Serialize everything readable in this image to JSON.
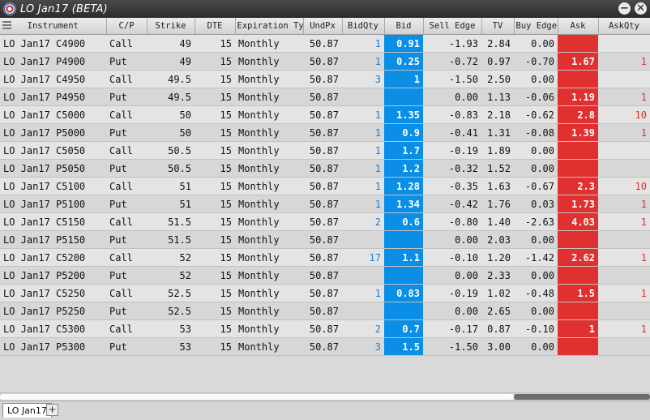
{
  "window": {
    "title": "LO Jan17 (BETA)"
  },
  "columns": [
    "Instrument",
    "C/P",
    "Strike",
    "DTE",
    "Expiration Typ",
    "UndPx",
    "BidQty",
    "Bid",
    "Sell Edge",
    "TV",
    "Buy Edge",
    "Ask",
    "AskQty"
  ],
  "rows": [
    {
      "instrument": "LO Jan17 C4900",
      "cp": "Call",
      "strike": "49",
      "dte": "15",
      "exp": "Monthly",
      "undpx": "50.87",
      "bidqty": "1",
      "bid": "0.91",
      "selledge": "-1.93",
      "tv": "2.84",
      "buyedge": "0.00",
      "ask": "",
      "askqty": ""
    },
    {
      "instrument": "LO Jan17 P4900",
      "cp": "Put",
      "strike": "49",
      "dte": "15",
      "exp": "Monthly",
      "undpx": "50.87",
      "bidqty": "1",
      "bid": "0.25",
      "selledge": "-0.72",
      "tv": "0.97",
      "buyedge": "-0.70",
      "ask": "1.67",
      "askqty": "1"
    },
    {
      "instrument": "LO Jan17 C4950",
      "cp": "Call",
      "strike": "49.5",
      "dte": "15",
      "exp": "Monthly",
      "undpx": "50.87",
      "bidqty": "3",
      "bid": "1",
      "selledge": "-1.50",
      "tv": "2.50",
      "buyedge": "0.00",
      "ask": "",
      "askqty": ""
    },
    {
      "instrument": "LO Jan17 P4950",
      "cp": "Put",
      "strike": "49.5",
      "dte": "15",
      "exp": "Monthly",
      "undpx": "50.87",
      "bidqty": "",
      "bid": "",
      "selledge": "0.00",
      "tv": "1.13",
      "buyedge": "-0.06",
      "ask": "1.19",
      "askqty": "1"
    },
    {
      "instrument": "LO Jan17 C5000",
      "cp": "Call",
      "strike": "50",
      "dte": "15",
      "exp": "Monthly",
      "undpx": "50.87",
      "bidqty": "1",
      "bid": "1.35",
      "selledge": "-0.83",
      "tv": "2.18",
      "buyedge": "-0.62",
      "ask": "2.8",
      "askqty": "10"
    },
    {
      "instrument": "LO Jan17 P5000",
      "cp": "Put",
      "strike": "50",
      "dte": "15",
      "exp": "Monthly",
      "undpx": "50.87",
      "bidqty": "1",
      "bid": "0.9",
      "selledge": "-0.41",
      "tv": "1.31",
      "buyedge": "-0.08",
      "ask": "1.39",
      "askqty": "1"
    },
    {
      "instrument": "LO Jan17 C5050",
      "cp": "Call",
      "strike": "50.5",
      "dte": "15",
      "exp": "Monthly",
      "undpx": "50.87",
      "bidqty": "1",
      "bid": "1.7",
      "selledge": "-0.19",
      "tv": "1.89",
      "buyedge": "0.00",
      "ask": "",
      "askqty": ""
    },
    {
      "instrument": "LO Jan17 P5050",
      "cp": "Put",
      "strike": "50.5",
      "dte": "15",
      "exp": "Monthly",
      "undpx": "50.87",
      "bidqty": "1",
      "bid": "1.2",
      "selledge": "-0.32",
      "tv": "1.52",
      "buyedge": "0.00",
      "ask": "",
      "askqty": ""
    },
    {
      "instrument": "LO Jan17 C5100",
      "cp": "Call",
      "strike": "51",
      "dte": "15",
      "exp": "Monthly",
      "undpx": "50.87",
      "bidqty": "1",
      "bid": "1.28",
      "selledge": "-0.35",
      "tv": "1.63",
      "buyedge": "-0.67",
      "ask": "2.3",
      "askqty": "10"
    },
    {
      "instrument": "LO Jan17 P5100",
      "cp": "Put",
      "strike": "51",
      "dte": "15",
      "exp": "Monthly",
      "undpx": "50.87",
      "bidqty": "1",
      "bid": "1.34",
      "selledge": "-0.42",
      "tv": "1.76",
      "buyedge": "0.03",
      "ask": "1.73",
      "askqty": "1"
    },
    {
      "instrument": "LO Jan17 C5150",
      "cp": "Call",
      "strike": "51.5",
      "dte": "15",
      "exp": "Monthly",
      "undpx": "50.87",
      "bidqty": "2",
      "bid": "0.6",
      "selledge": "-0.80",
      "tv": "1.40",
      "buyedge": "-2.63",
      "ask": "4.03",
      "askqty": "1"
    },
    {
      "instrument": "LO Jan17 P5150",
      "cp": "Put",
      "strike": "51.5",
      "dte": "15",
      "exp": "Monthly",
      "undpx": "50.87",
      "bidqty": "",
      "bid": "",
      "selledge": "0.00",
      "tv": "2.03",
      "buyedge": "0.00",
      "ask": "",
      "askqty": ""
    },
    {
      "instrument": "LO Jan17 C5200",
      "cp": "Call",
      "strike": "52",
      "dte": "15",
      "exp": "Monthly",
      "undpx": "50.87",
      "bidqty": "17",
      "bid": "1.1",
      "selledge": "-0.10",
      "tv": "1.20",
      "buyedge": "-1.42",
      "ask": "2.62",
      "askqty": "1"
    },
    {
      "instrument": "LO Jan17 P5200",
      "cp": "Put",
      "strike": "52",
      "dte": "15",
      "exp": "Monthly",
      "undpx": "50.87",
      "bidqty": "",
      "bid": "",
      "selledge": "0.00",
      "tv": "2.33",
      "buyedge": "0.00",
      "ask": "",
      "askqty": ""
    },
    {
      "instrument": "LO Jan17 C5250",
      "cp": "Call",
      "strike": "52.5",
      "dte": "15",
      "exp": "Monthly",
      "undpx": "50.87",
      "bidqty": "1",
      "bid": "0.83",
      "selledge": "-0.19",
      "tv": "1.02",
      "buyedge": "-0.48",
      "ask": "1.5",
      "askqty": "1"
    },
    {
      "instrument": "LO Jan17 P5250",
      "cp": "Put",
      "strike": "52.5",
      "dte": "15",
      "exp": "Monthly",
      "undpx": "50.87",
      "bidqty": "",
      "bid": "",
      "selledge": "0.00",
      "tv": "2.65",
      "buyedge": "0.00",
      "ask": "",
      "askqty": ""
    },
    {
      "instrument": "LO Jan17 C5300",
      "cp": "Call",
      "strike": "53",
      "dte": "15",
      "exp": "Monthly",
      "undpx": "50.87",
      "bidqty": "2",
      "bid": "0.7",
      "selledge": "-0.17",
      "tv": "0.87",
      "buyedge": "-0.10",
      "ask": "1",
      "askqty": "1"
    },
    {
      "instrument": "LO Jan17 P5300",
      "cp": "Put",
      "strike": "53",
      "dte": "15",
      "exp": "Monthly",
      "undpx": "50.87",
      "bidqty": "3",
      "bid": "1.5",
      "selledge": "-1.50",
      "tv": "3.00",
      "buyedge": "0.00",
      "ask": "",
      "askqty": ""
    }
  ],
  "tabs": [
    {
      "label": "LO Jan17"
    }
  ],
  "add_tab_label": "+",
  "colors": {
    "bid": "#0a8ee6",
    "ask": "#e03030",
    "qty": "#1a7fd6"
  },
  "icons": {
    "menu": "hamburger-icon",
    "minimize": "minus-icon",
    "close": "close-icon"
  }
}
